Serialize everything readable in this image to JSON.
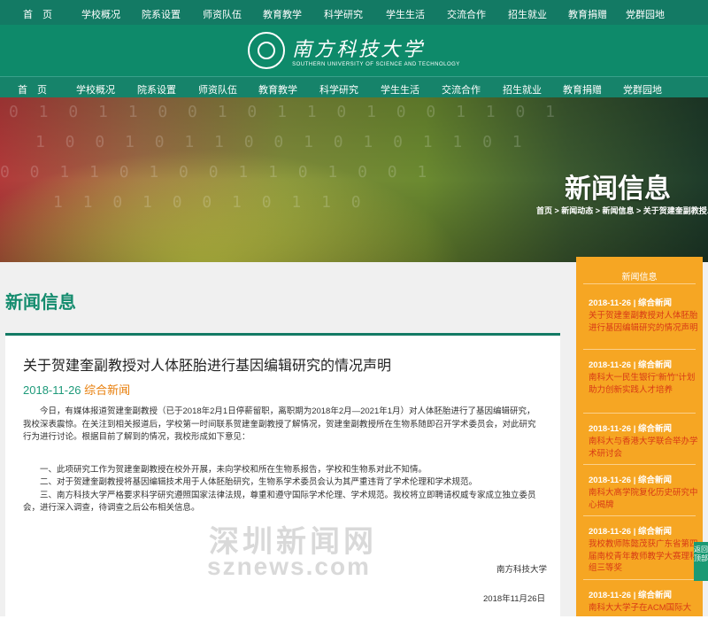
{
  "top_nav": [
    "首　页",
    "学校概况",
    "院系设置",
    "师资队伍",
    "教育教学",
    "科学研究",
    "学生生活",
    "交流合作",
    "招生就业",
    "教育捐赠",
    "党群园地"
  ],
  "logo": {
    "cn": "南方科技大学",
    "en": "SOUTHERN UNIVERSITY OF SCIENCE AND TECHNOLOGY"
  },
  "main_nav": [
    "首　页",
    "学校概况",
    "院系设置",
    "师资队伍",
    "教育教学",
    "科学研究",
    "学生生活",
    "交流合作",
    "招生就业",
    "教育捐赠",
    "党群园地"
  ],
  "banner": {
    "title": "新闻信息",
    "breadcrumb": "首页 > 新闻动态 > 新闻信息 > 关于贺建奎副教授..."
  },
  "page_heading": "新闻信息",
  "article": {
    "title": "关于贺建奎副教授对人体胚胎进行基因编辑研究的情况声明",
    "date": "2018-11-26",
    "category": "综合新闻",
    "paragraphs": [
      "今日，有媒体报道贺建奎副教授（已于2018年2月1日停薪留职，离职期为2018年2月—2021年1月）对人体胚胎进行了基因编辑研究，我校深表震惊。在关注到相关报道后，学校第一时间联系贺建奎副教授了解情况，贺建奎副教授所在生物系随即召开学术委员会，对此研究行为进行讨论。根据目前了解到的情况，我校形成如下意见：",
      "一、此项研究工作为贺建奎副教授在校外开展，未向学校和所在生物系报告，学校和生物系对此不知情。",
      "二、对于贺建奎副教授将基因编辑技术用于人体胚胎研究，生物系学术委员会认为其严重违背了学术伦理和学术规范。",
      "三、南方科技大学严格要求科学研究遵照国家法律法规，尊重和遵守国际学术伦理、学术规范。我校将立即聘请权威专家成立独立委员会，进行深入调查，待调查之后公布相关信息。"
    ],
    "signature": "南方科技大学",
    "sign_date": "2018年11月26日"
  },
  "watermark": {
    "line1": "深圳新闻网",
    "line2": "sznews.com"
  },
  "sidebar": {
    "title": "新闻信息",
    "items": [
      {
        "date": "2018-11-26 | 综合新闻",
        "text": "关于贺建奎副教授对人体胚胎进行基因编辑研究的情况声明"
      },
      {
        "date": "2018-11-26 | 综合新闻",
        "text": "南科大一民生银行“新竹”计划助力创新实践人才培养"
      },
      {
        "date": "2018-11-26 | 综合新闻",
        "text": "南科大与香港大学联合举办学术研讨会"
      },
      {
        "date": "2018-11-26 | 综合新闻",
        "text": "南科大高学院复化历史研究中心揭牌"
      },
      {
        "date": "2018-11-26 | 综合新闻",
        "text": "我校教师陈懿茂获广东省第四届南校青年教师教学大赛理科组三等奖"
      },
      {
        "date": "2018-11-26 | 综合新闻",
        "text": "南科大大学子在ACM国际大"
      }
    ]
  },
  "back_top": "返回顶部"
}
